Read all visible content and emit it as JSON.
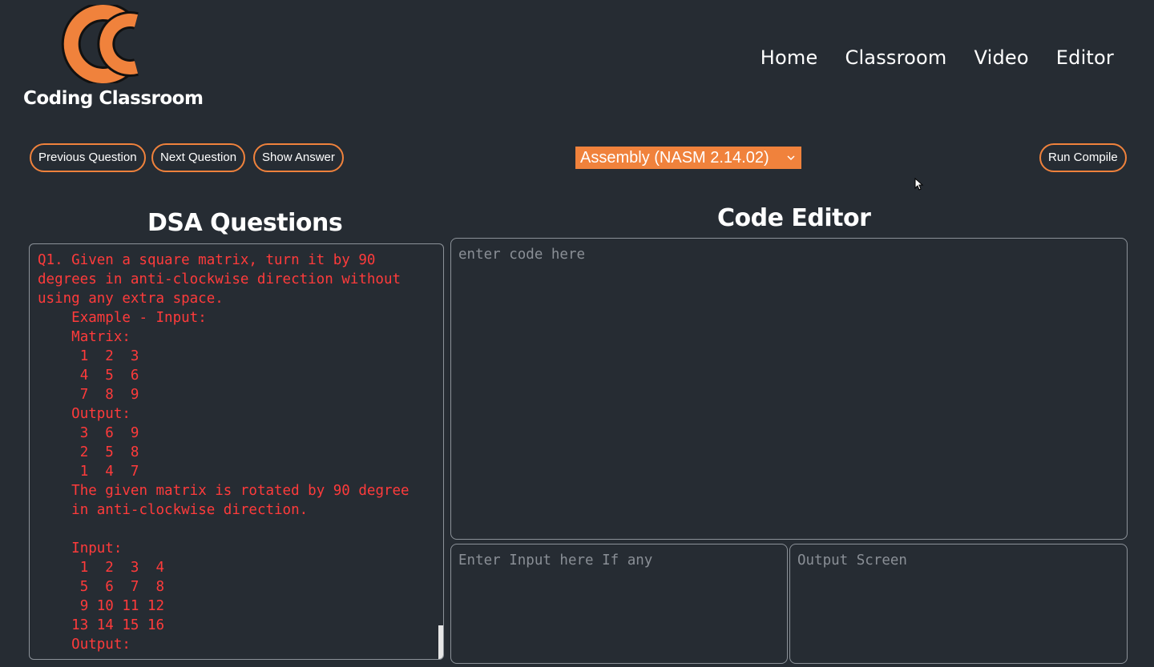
{
  "brand": {
    "name": "Coding Classroom"
  },
  "nav": {
    "home": "Home",
    "classroom": "Classroom",
    "video": "Video",
    "editor": "Editor"
  },
  "toolbar": {
    "previous_label": "Previous Question",
    "next_label": "Next Question",
    "show_answer_label": "Show Answer",
    "language_selected": "Assembly (NASM 2.14.02)",
    "run_label": "Run Compile"
  },
  "questions": {
    "title": "DSA Questions",
    "text": "Q1. Given a square matrix, turn it by 90 degrees in anti-clockwise direction without using any extra space.\n    Example - Input:\n    Matrix:\n     1  2  3\n     4  5  6\n     7  8  9\n    Output:\n     3  6  9\n     2  5  8\n     1  4  7\n    The given matrix is rotated by 90 degree\n    in anti-clockwise direction.\n\n    Input:\n     1  2  3  4\n     5  6  7  8\n     9 10 11 12\n    13 14 15 16\n    Output:"
  },
  "editor": {
    "title": "Code Editor",
    "code_placeholder": "enter code here",
    "input_placeholder": "Enter Input here If any",
    "output_placeholder": "Output Screen"
  },
  "colors": {
    "accent": "#f0823c",
    "background": "#262c33",
    "question_text": "#ff3b3b"
  },
  "icons": {
    "logo": "c-logo-icon",
    "dropdown": "chevron-down-icon",
    "cursor": "mouse-pointer-icon"
  }
}
